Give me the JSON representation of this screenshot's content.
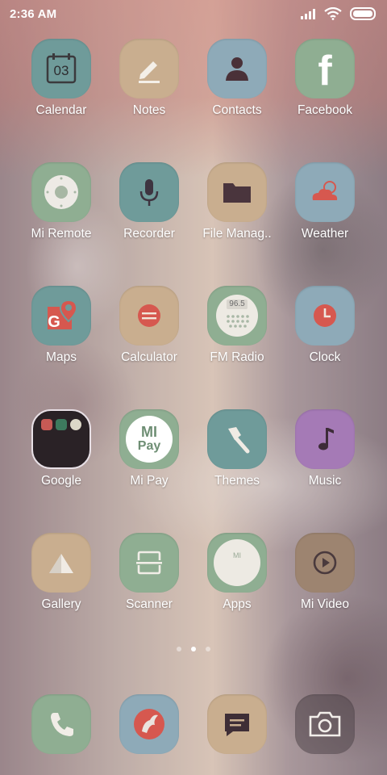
{
  "status": {
    "time": "2:36 AM"
  },
  "apps": [
    {
      "name": "Calendar",
      "icon": "calendar-icon",
      "badge": "03"
    },
    {
      "name": "Notes",
      "icon": "notes-pencil-icon"
    },
    {
      "name": "Contacts",
      "icon": "contacts-person-icon"
    },
    {
      "name": "Facebook",
      "icon": "facebook-icon",
      "glyph": "f"
    },
    {
      "name": "Mi Remote",
      "icon": "mi-remote-icon"
    },
    {
      "name": "Recorder",
      "icon": "microphone-icon"
    },
    {
      "name": "File Manag..",
      "icon": "folder-icon"
    },
    {
      "name": "Weather",
      "icon": "weather-cloud-icon"
    },
    {
      "name": "Maps",
      "icon": "maps-icon",
      "glyph": "G"
    },
    {
      "name": "Calculator",
      "icon": "calculator-icon"
    },
    {
      "name": "FM Radio",
      "icon": "radio-icon",
      "display": "96.5"
    },
    {
      "name": "Clock",
      "icon": "clock-icon"
    },
    {
      "name": "Google",
      "icon": "google-folder-icon"
    },
    {
      "name": "Mi Pay",
      "icon": "mi-pay-icon",
      "line1": "MI",
      "line2": "Pay"
    },
    {
      "name": "Themes",
      "icon": "themes-brush-icon"
    },
    {
      "name": "Music",
      "icon": "music-note-icon"
    },
    {
      "name": "Gallery",
      "icon": "gallery-mountain-icon"
    },
    {
      "name": "Scanner",
      "icon": "scanner-icon"
    },
    {
      "name": "Apps",
      "icon": "apps-bag-icon",
      "glyph": "MI"
    },
    {
      "name": "Mi Video",
      "icon": "video-play-icon"
    }
  ],
  "dock": [
    {
      "icon": "phone-icon"
    },
    {
      "icon": "browser-icon"
    },
    {
      "icon": "messages-icon"
    },
    {
      "icon": "camera-icon"
    }
  ],
  "pager": {
    "page": 2,
    "total": 3
  },
  "colors": {
    "green": "#8fae92",
    "tan": "#c9ae8f",
    "blue": "#8eaab8",
    "teal": "#6f9b9a",
    "purple": "#a57ab6",
    "red": "#d6584f"
  }
}
